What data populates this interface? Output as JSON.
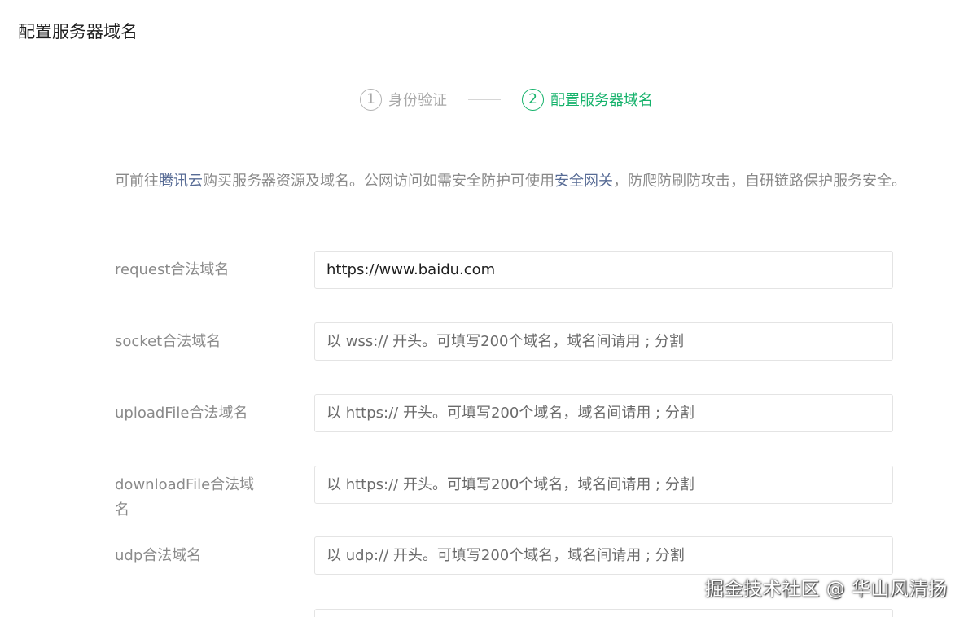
{
  "page": {
    "title": "配置服务器域名"
  },
  "steps": [
    {
      "num": "1",
      "label": "身份验证",
      "active": false
    },
    {
      "num": "2",
      "label": "配置服务器域名",
      "active": true
    }
  ],
  "intro": {
    "prefix": "可前往",
    "link1": "腾讯云",
    "middle": "购买服务器资源及域名。公网访问如需安全防护可使用",
    "link2": "安全网关",
    "suffix": "，防爬防刷防攻击，自研链路保护服务安全。"
  },
  "fields": [
    {
      "label": "request合法域名",
      "value": "https://www.baidu.com",
      "placeholder": ""
    },
    {
      "label": "socket合法域名",
      "value": "",
      "placeholder": "以 wss:// 开头。可填写200个域名，域名间请用 ; 分割"
    },
    {
      "label": "uploadFile合法域名",
      "value": "",
      "placeholder": "以 https:// 开头。可填写200个域名，域名间请用 ; 分割"
    },
    {
      "label": "downloadFile合法域名",
      "value": "",
      "placeholder": "以 https:// 开头。可填写200个域名，域名间请用 ; 分割"
    },
    {
      "label": "udp合法域名",
      "value": "",
      "placeholder": "以 udp:// 开头。可填写200个域名，域名间请用 ; 分割"
    }
  ],
  "watermark": "掘金技术社区 @ 华山风清扬",
  "colors": {
    "accent": "#15b26b",
    "link": "#576b95",
    "muted": "#8a8a8a"
  }
}
